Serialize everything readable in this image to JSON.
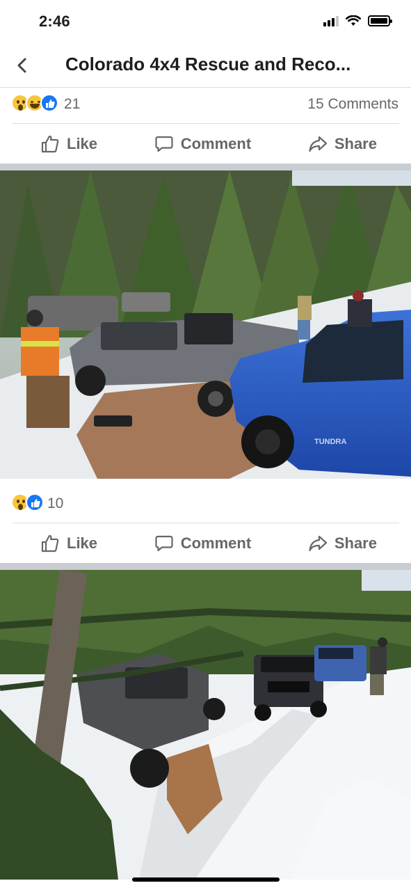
{
  "status_bar": {
    "time": "2:46"
  },
  "header": {
    "title": "Colorado 4x4 Rescue and Reco..."
  },
  "post1": {
    "reaction_count": "21",
    "comment_count": "15 Comments",
    "actions": {
      "like": "Like",
      "comment": "Comment",
      "share": "Share"
    }
  },
  "post2": {
    "reaction_count": "10",
    "actions": {
      "like": "Like",
      "comment": "Comment",
      "share": "Share"
    },
    "photo_text": {
      "blue_truck_badge": "TUNDRA"
    }
  },
  "colors": {
    "accent": "#1877f2",
    "muted_text": "#65676b",
    "divider": "#c9ccd1"
  },
  "icons": [
    "chevron-left-icon",
    "signal-icon",
    "wifi-icon",
    "battery-icon",
    "thumbs-up-icon",
    "comment-bubble-icon",
    "share-arrow-icon"
  ]
}
